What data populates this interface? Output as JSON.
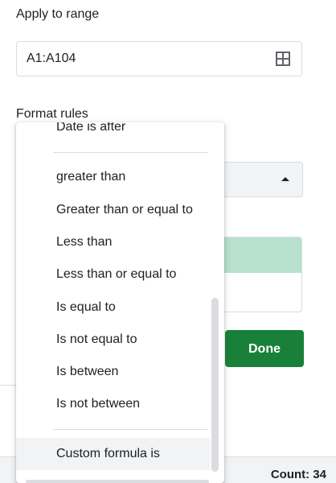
{
  "panel": {
    "apply_to_range_label": "Apply to range",
    "range_value": "A1:A104",
    "format_rules_label": "Format rules",
    "done_label": "Done"
  },
  "icons": {
    "range_picker": "grid-icon",
    "select_arrow": "caret-up-icon"
  },
  "dropdown": {
    "items": [
      "Date is after",
      "greater than",
      "Greater than or equal to",
      "Less than",
      "Less than or equal to",
      "Is equal to",
      "Is not equal to",
      "Is between",
      "Is not between",
      "Custom formula is"
    ],
    "hovered": "Custom formula is"
  },
  "status": {
    "count": "Count: 34"
  },
  "colors": {
    "done_button": "#188038",
    "preview_fill": "#b7e1cd",
    "select_bg": "#f1f3f4"
  }
}
